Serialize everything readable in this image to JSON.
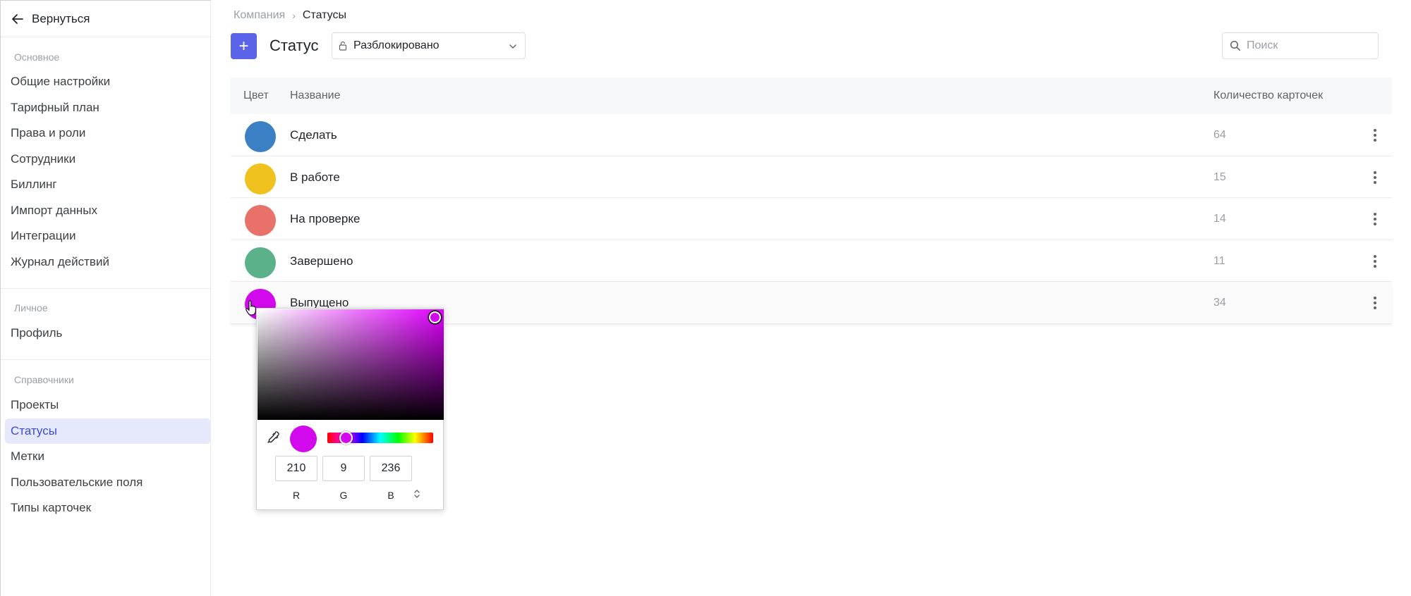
{
  "sidebar": {
    "back_label": "Вернуться",
    "groups": [
      {
        "title": "Основное",
        "items": [
          "Общие настройки",
          "Тарифный план",
          "Права и роли",
          "Сотрудники",
          "Биллинг",
          "Импорт данных",
          "Интеграции",
          "Журнал действий"
        ]
      },
      {
        "title": "Личное",
        "items": [
          "Профиль"
        ]
      },
      {
        "title": "Справочники",
        "items": [
          "Проекты",
          "Статусы",
          "Метки",
          "Пользовательские поля",
          "Типы карточек"
        ]
      }
    ],
    "active_item": "Статусы"
  },
  "breadcrumb": {
    "parent": "Компания",
    "separator": "›",
    "current": "Статусы"
  },
  "header": {
    "add_label": "+",
    "title": "Статус",
    "select_value": "Разблокировано",
    "search_placeholder": "Поиск",
    "search_value": ""
  },
  "table": {
    "columns": {
      "color": "Цвет",
      "name": "Название",
      "count": "Количество карточек"
    },
    "rows": [
      {
        "name": "Сделать",
        "count": "64",
        "color": "#3b7fc4"
      },
      {
        "name": "В работе",
        "count": "15",
        "color": "#efc21f"
      },
      {
        "name": "На проверке",
        "count": "14",
        "color": "#e8716a"
      },
      {
        "name": "Завершено",
        "count": "11",
        "color": "#5bb28a"
      },
      {
        "name": "Выпущено",
        "count": "34",
        "color": "#d209ec"
      }
    ]
  },
  "color_picker": {
    "r": "210",
    "g": "9",
    "b": "236",
    "r_label": "R",
    "g_label": "G",
    "b_label": "B",
    "current_color": "#d209ec",
    "hue_color": "#e000ff"
  },
  "colors": {
    "accent": "#5b64e8",
    "active_bg": "#e6e8fb",
    "active_text": "#3f4bd1"
  }
}
